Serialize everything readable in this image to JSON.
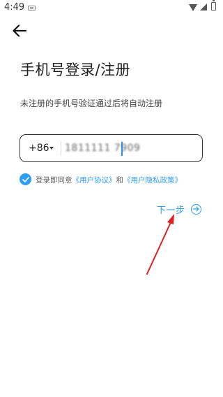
{
  "status_bar": {
    "time": "4:49",
    "icons": [
      "keyboard-icon",
      "wifi-icon",
      "signal-icon",
      "battery-icon"
    ]
  },
  "header": {
    "back_icon": "arrow-left-icon"
  },
  "page": {
    "title": "手机号登录/注册",
    "subtitle": "未注册的手机号验证通过后将自动注册"
  },
  "phone_form": {
    "country_code": "+86",
    "phone_value": "1811111 7909"
  },
  "agreement": {
    "checked": true,
    "prefix": "登录即同意",
    "user_agreement": "《用户协议》",
    "conjunction": "和",
    "privacy_policy": "《用户隐私政策》"
  },
  "next": {
    "label": "下一步"
  },
  "colors": {
    "accent": "#2e9ef4",
    "annotation": "#e02020"
  }
}
